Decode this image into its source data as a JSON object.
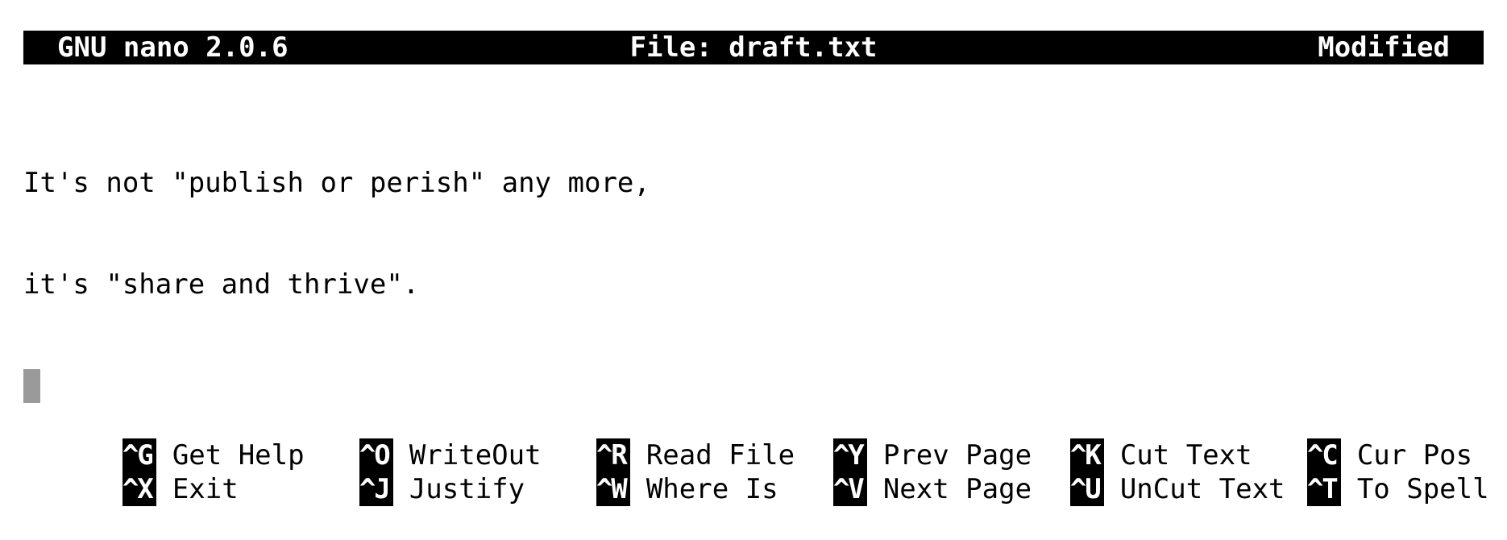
{
  "titlebar": {
    "app": "GNU nano 2.0.6",
    "file": "File: draft.txt",
    "status": "Modified"
  },
  "editor": {
    "lines": [
      "It's not \"publish or perish\" any more,",
      "it's \"share and thrive\"."
    ]
  },
  "shortcuts": {
    "row1": [
      {
        "key": "^G",
        "label": "Get Help"
      },
      {
        "key": "^O",
        "label": "WriteOut"
      },
      {
        "key": "^R",
        "label": "Read File"
      },
      {
        "key": "^Y",
        "label": "Prev Page"
      },
      {
        "key": "^K",
        "label": "Cut Text"
      },
      {
        "key": "^C",
        "label": "Cur Pos"
      }
    ],
    "row2": [
      {
        "key": "^X",
        "label": "Exit"
      },
      {
        "key": "^J",
        "label": "Justify"
      },
      {
        "key": "^W",
        "label": "Where Is"
      },
      {
        "key": "^V",
        "label": "Next Page"
      },
      {
        "key": "^U",
        "label": "UnCut Text"
      },
      {
        "key": "^T",
        "label": "To Spell"
      }
    ]
  }
}
